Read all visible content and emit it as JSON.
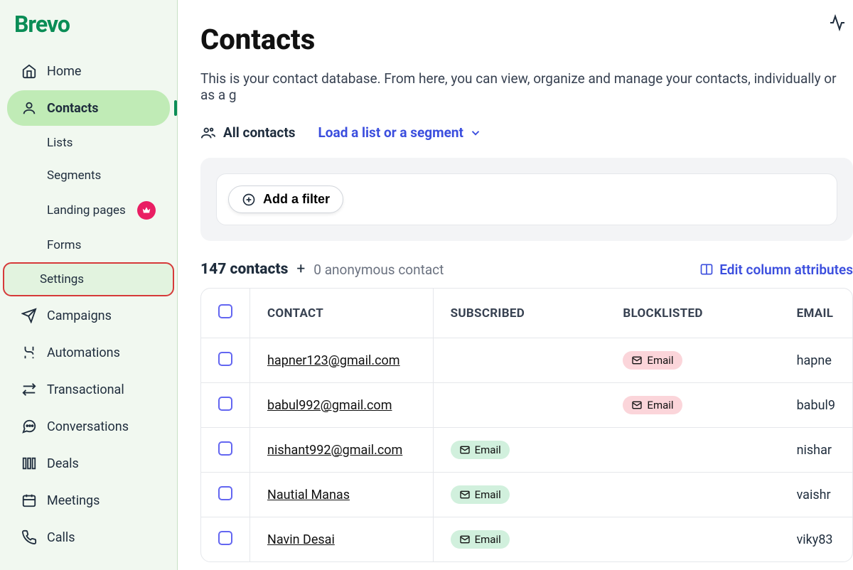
{
  "brand": "Brevo",
  "sidebar": {
    "items": [
      {
        "label": "Home",
        "icon": "home"
      },
      {
        "label": "Contacts",
        "icon": "contacts",
        "active": true
      },
      {
        "label": "Campaigns",
        "icon": "send"
      },
      {
        "label": "Automations",
        "icon": "automation"
      },
      {
        "label": "Transactional",
        "icon": "transactional"
      },
      {
        "label": "Conversations",
        "icon": "chat"
      },
      {
        "label": "Deals",
        "icon": "deals"
      },
      {
        "label": "Meetings",
        "icon": "calendar"
      },
      {
        "label": "Calls",
        "icon": "phone"
      }
    ],
    "sub_items": {
      "lists": "Lists",
      "segments": "Segments",
      "landing": "Landing pages",
      "forms": "Forms",
      "settings": "Settings"
    }
  },
  "page": {
    "title": "Contacts",
    "subtitle": "This is your contact database. From here, you can view, organize and manage your contacts, individually or as a g"
  },
  "tabs": {
    "all": "All contacts",
    "load": "Load a list or a segment"
  },
  "filter": {
    "add": "Add a filter"
  },
  "count": {
    "total": "147 contacts",
    "plus": "+",
    "anon": "0 anonymous contact"
  },
  "actions": {
    "edit_cols": "Edit column attributes"
  },
  "table": {
    "headers": {
      "contact": "CONTACT",
      "subscribed": "SUBSCRIBED",
      "blocklisted": "BLOCKLISTED",
      "email": "EMAIL"
    },
    "rows": [
      {
        "contact": "hapner123@gmail.com",
        "subscribed_email": false,
        "blocklisted_email": true,
        "email": "hapne"
      },
      {
        "contact": "babul992@gmail.com",
        "subscribed_email": false,
        "blocklisted_email": true,
        "email": "babul9"
      },
      {
        "contact": "nishant992@gmail.com",
        "subscribed_email": true,
        "blocklisted_email": false,
        "email": "nishar"
      },
      {
        "contact": "Nautial Manas",
        "subscribed_email": true,
        "blocklisted_email": false,
        "email": "vaishr"
      },
      {
        "contact": "Navin Desai",
        "subscribed_email": true,
        "blocklisted_email": false,
        "email": "viky83"
      }
    ],
    "pill_label": "Email"
  }
}
